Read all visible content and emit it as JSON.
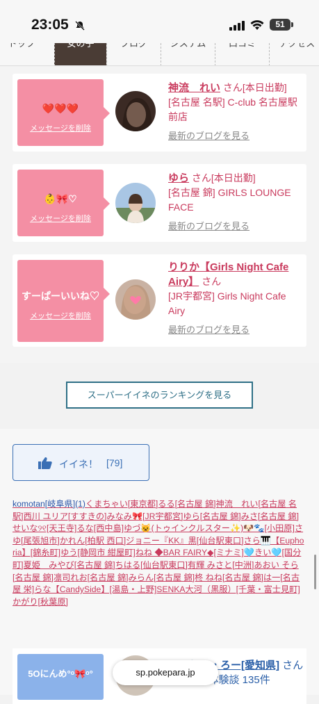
{
  "status": {
    "time": "23:05",
    "battery": "51"
  },
  "tabs": [
    "トップ",
    "女の子",
    "ブログ",
    "システム",
    "口コミ",
    "アクセス"
  ],
  "cards": [
    {
      "message": "❤️❤️❤️",
      "delete": "メッセージを削除",
      "name": "神流　れい",
      "san": "さん",
      "status": "[本日出勤]",
      "shop": "[名古屋 名駅] C-club 名古屋駅前店",
      "blog": "最新のブログを見る"
    },
    {
      "message": "👶🎀♡",
      "delete": "メッセージを削除",
      "name": "ゆら",
      "san": "さん",
      "status": "[本日出勤]",
      "shop": "[名古屋 錦] GIRLS LOUNGE FACE",
      "blog": "最新のブログを見る"
    },
    {
      "message": "すーぱーいいね♡",
      "delete": "メッセージを削除",
      "name": "りりか【Girls Night Cafe Airy】",
      "san": "さん",
      "status": "",
      "shop": "[JR宇都宮] Girls Night Cafe Airy",
      "blog": "最新のブログを見る"
    }
  ],
  "ranking_button": "スーパーイイネのランキングを見る",
  "like": {
    "label": "イイネ！",
    "count": "[79]"
  },
  "likers_first": "komotan[岐阜県](1)",
  "likers_rest": "くまちゃい[東京都]るる[名古屋 錦]神流　れい[名古屋 名駅]西川 ユリア[すすきの]みなみ🎀[JR宇都宮]ゆら[名古屋 錦]みさ[名古屋 錦]せいな୨୧[天王寺]るな[西中島]ゆづ😺(トゥインクルスター✨)🐶🐾[小田原]さゆ[尾張旭市]かれん[柏駅 西口]ジョニー『KK』黒[仙台駅東口]さら🎹【Euphoria】[錦糸町]ゆう[静岡市 紺屋町]ねね ◆BAR FAIRY◆[ミナミ]🩵きい🩵[国分町]夏姫　みやび[名古屋 錦]ちはる[仙台駅東口]有輝 みさと[中洲]あおい そら[名古屋 錦]凛司れお[名古屋 錦]みらん[名古屋 錦]柊 ねね[名古屋 錦]は一[名古屋 栄]らな【CandySide】[湯島・上野]SENKA大河（黒服）[千葉・富士見町]かがり[秋葉原]",
  "bottom_card": {
    "message": "5Oにんめ°ᵒ🎀ᵒ°",
    "name": "ろーりー・ろー[愛知県]",
    "san": "さん",
    "detail": "[愛知県] 体験談 135件"
  },
  "url_pill": "sp.pokepara.jp"
}
